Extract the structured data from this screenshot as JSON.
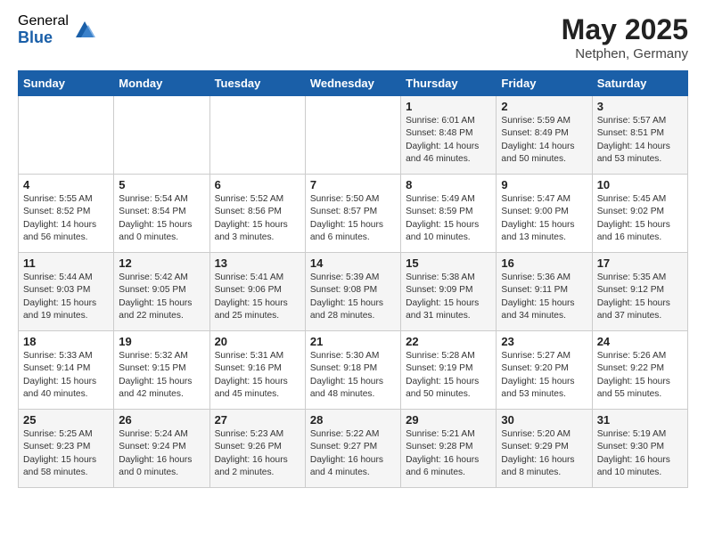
{
  "header": {
    "logo_general": "General",
    "logo_blue": "Blue",
    "month": "May 2025",
    "location": "Netphen, Germany"
  },
  "weekdays": [
    "Sunday",
    "Monday",
    "Tuesday",
    "Wednesday",
    "Thursday",
    "Friday",
    "Saturday"
  ],
  "weeks": [
    [
      {
        "day": "",
        "sunrise": "",
        "sunset": "",
        "daylight": ""
      },
      {
        "day": "",
        "sunrise": "",
        "sunset": "",
        "daylight": ""
      },
      {
        "day": "",
        "sunrise": "",
        "sunset": "",
        "daylight": ""
      },
      {
        "day": "",
        "sunrise": "",
        "sunset": "",
        "daylight": ""
      },
      {
        "day": "1",
        "sunrise": "Sunrise: 6:01 AM",
        "sunset": "Sunset: 8:48 PM",
        "daylight": "Daylight: 14 hours and 46 minutes."
      },
      {
        "day": "2",
        "sunrise": "Sunrise: 5:59 AM",
        "sunset": "Sunset: 8:49 PM",
        "daylight": "Daylight: 14 hours and 50 minutes."
      },
      {
        "day": "3",
        "sunrise": "Sunrise: 5:57 AM",
        "sunset": "Sunset: 8:51 PM",
        "daylight": "Daylight: 14 hours and 53 minutes."
      }
    ],
    [
      {
        "day": "4",
        "sunrise": "Sunrise: 5:55 AM",
        "sunset": "Sunset: 8:52 PM",
        "daylight": "Daylight: 14 hours and 56 minutes."
      },
      {
        "day": "5",
        "sunrise": "Sunrise: 5:54 AM",
        "sunset": "Sunset: 8:54 PM",
        "daylight": "Daylight: 15 hours and 0 minutes."
      },
      {
        "day": "6",
        "sunrise": "Sunrise: 5:52 AM",
        "sunset": "Sunset: 8:56 PM",
        "daylight": "Daylight: 15 hours and 3 minutes."
      },
      {
        "day": "7",
        "sunrise": "Sunrise: 5:50 AM",
        "sunset": "Sunset: 8:57 PM",
        "daylight": "Daylight: 15 hours and 6 minutes."
      },
      {
        "day": "8",
        "sunrise": "Sunrise: 5:49 AM",
        "sunset": "Sunset: 8:59 PM",
        "daylight": "Daylight: 15 hours and 10 minutes."
      },
      {
        "day": "9",
        "sunrise": "Sunrise: 5:47 AM",
        "sunset": "Sunset: 9:00 PM",
        "daylight": "Daylight: 15 hours and 13 minutes."
      },
      {
        "day": "10",
        "sunrise": "Sunrise: 5:45 AM",
        "sunset": "Sunset: 9:02 PM",
        "daylight": "Daylight: 15 hours and 16 minutes."
      }
    ],
    [
      {
        "day": "11",
        "sunrise": "Sunrise: 5:44 AM",
        "sunset": "Sunset: 9:03 PM",
        "daylight": "Daylight: 15 hours and 19 minutes."
      },
      {
        "day": "12",
        "sunrise": "Sunrise: 5:42 AM",
        "sunset": "Sunset: 9:05 PM",
        "daylight": "Daylight: 15 hours and 22 minutes."
      },
      {
        "day": "13",
        "sunrise": "Sunrise: 5:41 AM",
        "sunset": "Sunset: 9:06 PM",
        "daylight": "Daylight: 15 hours and 25 minutes."
      },
      {
        "day": "14",
        "sunrise": "Sunrise: 5:39 AM",
        "sunset": "Sunset: 9:08 PM",
        "daylight": "Daylight: 15 hours and 28 minutes."
      },
      {
        "day": "15",
        "sunrise": "Sunrise: 5:38 AM",
        "sunset": "Sunset: 9:09 PM",
        "daylight": "Daylight: 15 hours and 31 minutes."
      },
      {
        "day": "16",
        "sunrise": "Sunrise: 5:36 AM",
        "sunset": "Sunset: 9:11 PM",
        "daylight": "Daylight: 15 hours and 34 minutes."
      },
      {
        "day": "17",
        "sunrise": "Sunrise: 5:35 AM",
        "sunset": "Sunset: 9:12 PM",
        "daylight": "Daylight: 15 hours and 37 minutes."
      }
    ],
    [
      {
        "day": "18",
        "sunrise": "Sunrise: 5:33 AM",
        "sunset": "Sunset: 9:14 PM",
        "daylight": "Daylight: 15 hours and 40 minutes."
      },
      {
        "day": "19",
        "sunrise": "Sunrise: 5:32 AM",
        "sunset": "Sunset: 9:15 PM",
        "daylight": "Daylight: 15 hours and 42 minutes."
      },
      {
        "day": "20",
        "sunrise": "Sunrise: 5:31 AM",
        "sunset": "Sunset: 9:16 PM",
        "daylight": "Daylight: 15 hours and 45 minutes."
      },
      {
        "day": "21",
        "sunrise": "Sunrise: 5:30 AM",
        "sunset": "Sunset: 9:18 PM",
        "daylight": "Daylight: 15 hours and 48 minutes."
      },
      {
        "day": "22",
        "sunrise": "Sunrise: 5:28 AM",
        "sunset": "Sunset: 9:19 PM",
        "daylight": "Daylight: 15 hours and 50 minutes."
      },
      {
        "day": "23",
        "sunrise": "Sunrise: 5:27 AM",
        "sunset": "Sunset: 9:20 PM",
        "daylight": "Daylight: 15 hours and 53 minutes."
      },
      {
        "day": "24",
        "sunrise": "Sunrise: 5:26 AM",
        "sunset": "Sunset: 9:22 PM",
        "daylight": "Daylight: 15 hours and 55 minutes."
      }
    ],
    [
      {
        "day": "25",
        "sunrise": "Sunrise: 5:25 AM",
        "sunset": "Sunset: 9:23 PM",
        "daylight": "Daylight: 15 hours and 58 minutes."
      },
      {
        "day": "26",
        "sunrise": "Sunrise: 5:24 AM",
        "sunset": "Sunset: 9:24 PM",
        "daylight": "Daylight: 16 hours and 0 minutes."
      },
      {
        "day": "27",
        "sunrise": "Sunrise: 5:23 AM",
        "sunset": "Sunset: 9:26 PM",
        "daylight": "Daylight: 16 hours and 2 minutes."
      },
      {
        "day": "28",
        "sunrise": "Sunrise: 5:22 AM",
        "sunset": "Sunset: 9:27 PM",
        "daylight": "Daylight: 16 hours and 4 minutes."
      },
      {
        "day": "29",
        "sunrise": "Sunrise: 5:21 AM",
        "sunset": "Sunset: 9:28 PM",
        "daylight": "Daylight: 16 hours and 6 minutes."
      },
      {
        "day": "30",
        "sunrise": "Sunrise: 5:20 AM",
        "sunset": "Sunset: 9:29 PM",
        "daylight": "Daylight: 16 hours and 8 minutes."
      },
      {
        "day": "31",
        "sunrise": "Sunrise: 5:19 AM",
        "sunset": "Sunset: 9:30 PM",
        "daylight": "Daylight: 16 hours and 10 minutes."
      }
    ]
  ]
}
